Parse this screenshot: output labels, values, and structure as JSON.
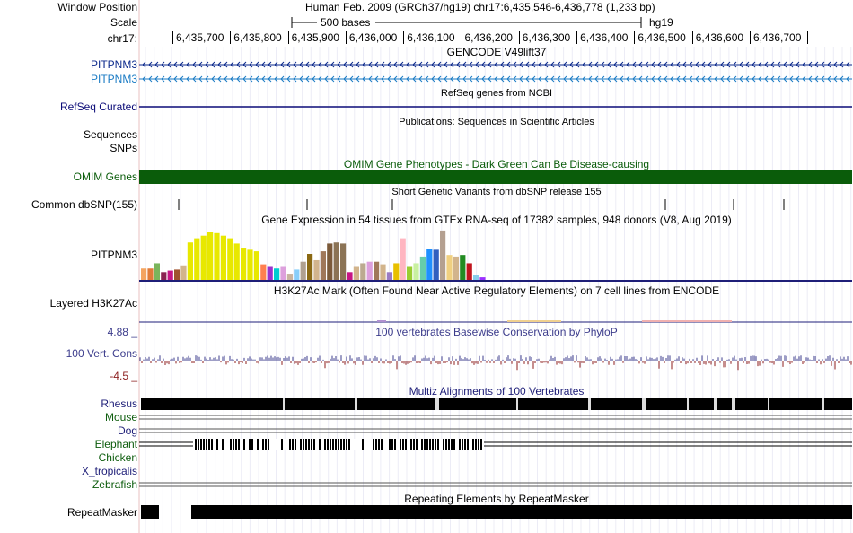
{
  "header": {
    "window_label": "Window Position",
    "window_value": "Human Feb. 2009 (GRCh37/hg19)   chr17:6,435,546-6,436,778 (1,233 bp)",
    "scale_label": "Scale",
    "scale_value": "500 bases",
    "assembly": "hg19",
    "chrom_label": "chr17:",
    "ticks": [
      "6,435,700",
      "6,435,800",
      "6,435,900",
      "6,436,000",
      "6,436,100",
      "6,436,200",
      "6,436,300",
      "6,436,400",
      "6,436,500",
      "6,436,600",
      "6,436,700"
    ]
  },
  "tracks": {
    "gencode": {
      "title": "GENCODE V49lift37",
      "gene1": "PITPNM3",
      "gene2": "PITPNM3",
      "color1": "#0c2a8c",
      "color2": "#1a7bc4"
    },
    "refseq": {
      "title": "RefSeq genes from NCBI",
      "label": "RefSeq Curated",
      "color": "#0c0c78"
    },
    "pubs": {
      "title": "Publications: Sequences in Scientific Articles",
      "label1": "Sequences",
      "label2": "SNPs"
    },
    "omim": {
      "title": "OMIM Gene Phenotypes - Dark Green Can Be Disease-causing",
      "label": "OMIM Genes",
      "color": "#0a5c0a"
    },
    "dbsnp": {
      "title": "Short Genetic Variants from dbSNP release 155",
      "label": "Common dbSNP(155)"
    },
    "gtex": {
      "title": "Gene Expression in 54 tissues from GTEx RNA-seq of 17382 samples, 948 donors (V8, Aug 2019)",
      "label": "PITPNM3",
      "levels": [
        0.22,
        0.22,
        0.32,
        0.15,
        0.18,
        0.2,
        0.28,
        0.72,
        0.8,
        0.85,
        0.92,
        0.9,
        0.85,
        0.8,
        0.7,
        0.62,
        0.58,
        0.55,
        0.3,
        0.25,
        0.22,
        0.25,
        0.12,
        0.2,
        0.35,
        0.5,
        0.38,
        0.55,
        0.7,
        0.72,
        0.7,
        0.15,
        0.25,
        0.32,
        0.35,
        0.35,
        0.3,
        0.15,
        0.32,
        0.8,
        0.25,
        0.32,
        0.45,
        0.6,
        0.58,
        0.95,
        0.48,
        0.45,
        0.48,
        0.32,
        0.1,
        0.05
      ],
      "colors": [
        "#f4a460",
        "#e07b39",
        "#7ab55c",
        "#8b2252",
        "#c71585",
        "#a0522d",
        "#d2b48c",
        "#e8e800",
        "#e8e800",
        "#e8e800",
        "#e8e800",
        "#e8e800",
        "#e8e800",
        "#e8e800",
        "#e8e800",
        "#e8e800",
        "#e8e800",
        "#e8e800",
        "#ff7f50",
        "#9a32cd",
        "#00ced1",
        "#dda0dd",
        "#c8b4a0",
        "#87cefa",
        "#b0a090",
        "#8b6914",
        "#d2b48c",
        "#a0785a",
        "#7b5a3a",
        "#8b7355",
        "#8b7355",
        "#c71585",
        "#d2b48c",
        "#bcaa90",
        "#dda0dd",
        "#a0785a",
        "#d2b48c",
        "#9a7bc4",
        "#e8c000",
        "#ffb6c1",
        "#9acd32",
        "#c8f0a0",
        "#66cdaa",
        "#1e90ff",
        "#3060c0",
        "#b4a090",
        "#f0d080",
        "#d2b48c",
        "#228b22",
        "#c0141e",
        "#87ceeb",
        "#9b30ff"
      ]
    },
    "h3k27ac": {
      "title": "H3K27Ac Mark (Often Found Near Active Regulatory Elements) on 7 cell lines from ENCODE",
      "label": "Layered H3K27Ac"
    },
    "phylop": {
      "title": "100 vertebrates Basewise Conservation by PhyloP",
      "label": "100 Vert. Cons",
      "max": "4.88 _",
      "min": "-4.5 _",
      "color": "#3c3c8c",
      "neg_color": "#8c1e1e"
    },
    "multiz": {
      "title": "Multiz Alignments of 100 Vertebrates",
      "species": [
        {
          "name": "Rhesus",
          "color": "#1e1e78"
        },
        {
          "name": "Mouse",
          "color": "#0c5c0c"
        },
        {
          "name": "Dog",
          "color": "#1e1e78"
        },
        {
          "name": "Elephant",
          "color": "#0c5c0c"
        },
        {
          "name": "Chicken",
          "color": "#0c5c0c"
        },
        {
          "name": "X_tropicalis",
          "color": "#1e1e78"
        },
        {
          "name": "Zebrafish",
          "color": "#0c5c0c"
        }
      ]
    },
    "rmsk": {
      "title": "Repeating Elements by RepeatMasker",
      "label": "RepeatMasker"
    }
  }
}
